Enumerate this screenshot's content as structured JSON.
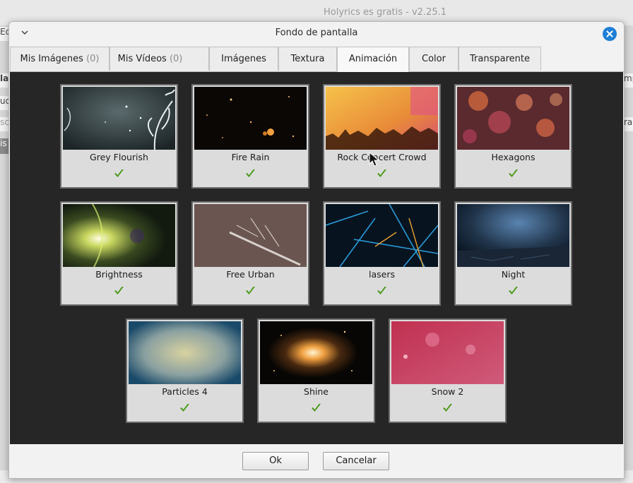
{
  "app": {
    "window_title": "Holyrics es gratis - v2.25.1",
    "left_edge_fragments": [
      "Ed",
      "la",
      "ud",
      "sc",
      "is"
    ],
    "right_edge_fragments": [
      "mp",
      "ra"
    ]
  },
  "dialog": {
    "title": "Fondo de pantalla",
    "tabs": [
      {
        "label": "Mis Imágenes",
        "count": "(0)"
      },
      {
        "label": "Mis Vídeos",
        "count": "(0)"
      },
      {
        "label": "Imágenes",
        "count": ""
      },
      {
        "label": "Textura",
        "count": ""
      },
      {
        "label": "Animación",
        "count": "",
        "active": true
      },
      {
        "label": "Color",
        "count": ""
      },
      {
        "label": "Transparente",
        "count": ""
      }
    ],
    "items": [
      {
        "label": "Grey Flourish",
        "selected": true
      },
      {
        "label": "Fire Rain",
        "selected": true
      },
      {
        "label": "Rock Concert Crowd",
        "selected": true
      },
      {
        "label": "Hexagons",
        "selected": true
      },
      {
        "label": "Brightness",
        "selected": true
      },
      {
        "label": "Free Urban",
        "selected": true
      },
      {
        "label": "lasers",
        "selected": true
      },
      {
        "label": "Night",
        "selected": true
      },
      {
        "label": "Particles 4",
        "selected": true
      },
      {
        "label": "Shine",
        "selected": true
      },
      {
        "label": "Snow 2",
        "selected": true
      }
    ],
    "buttons": {
      "ok": "Ok",
      "cancel": "Cancelar"
    }
  },
  "colors": {
    "accent": "#1f7fd6",
    "check": "#4a9a1a",
    "grid_bg": "#262626"
  }
}
